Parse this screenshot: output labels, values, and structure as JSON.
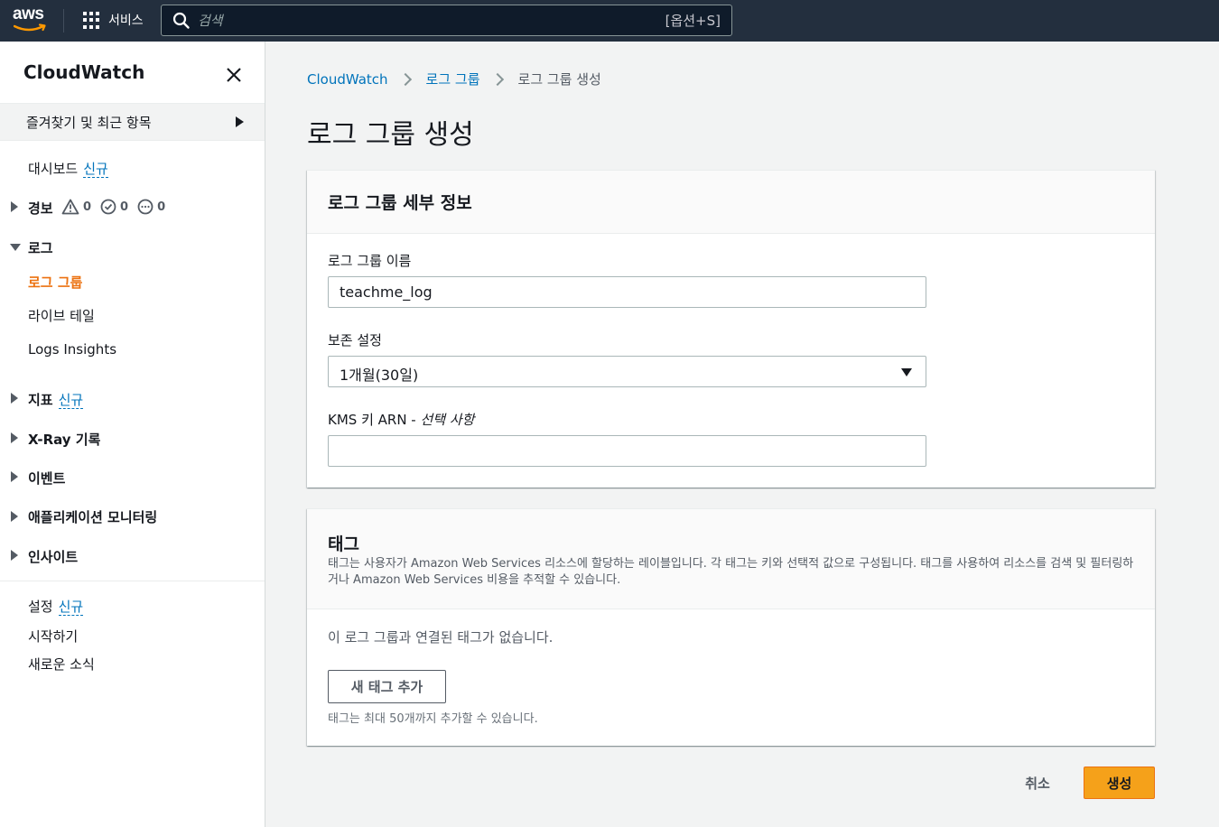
{
  "topbar": {
    "logo_text": "aws",
    "services_label": "서비스",
    "search_placeholder": "검색",
    "search_shortcut": "[옵션+S]"
  },
  "sidebar": {
    "title": "CloudWatch",
    "favorites_label": "즐겨찾기 및 최근 항목",
    "new_badge": "신규",
    "items": {
      "dashboard": "대시보드",
      "alarms": "경보",
      "alarm_counts": [
        "0",
        "0",
        "0"
      ],
      "logs": "로그",
      "log_groups": "로그 그룹",
      "live_tail": "라이브 테일",
      "logs_insights": "Logs Insights",
      "metrics": "지표",
      "xray": "X-Ray 기록",
      "events": "이벤트",
      "app_monitoring": "애플리케이션 모니터링",
      "insights": "인사이트",
      "settings": "설정",
      "getting_started": "시작하기",
      "whats_new": "새로운 소식"
    }
  },
  "breadcrumb": {
    "items": [
      "CloudWatch",
      "로그 그룹",
      "로그 그룹 생성"
    ]
  },
  "page_title": "로그 그룹 생성",
  "details_panel": {
    "title": "로그 그룹 세부 정보",
    "name_label": "로그 그룹 이름",
    "name_value": "teachme_log",
    "retention_label": "보존 설정",
    "retention_value": "1개월(30일)",
    "kms_label": "KMS 키 ARN - ",
    "kms_optional": "선택 사항",
    "kms_value": ""
  },
  "tags_panel": {
    "title": "태그",
    "description": "태그는 사용자가 Amazon Web Services 리소스에 할당하는 레이블입니다. 각 태그는 키와 선택적 값으로 구성됩니다. 태그를 사용하여 리소스를 검색 및 필터링하거나 Amazon Web Services 비용을 추적할 수 있습니다.",
    "empty_text": "이 로그 그룹과 연결된 태그가 없습니다.",
    "add_button": "새 태그 추가",
    "hint": "태그는 최대 50개까지 추가할 수 있습니다."
  },
  "footer": {
    "cancel_label": "취소",
    "create_label": "생성"
  },
  "colors": {
    "topbar": "#232f3e",
    "link": "#0073bb",
    "active": "#ec7211",
    "primary_button": "#f5a11a"
  }
}
